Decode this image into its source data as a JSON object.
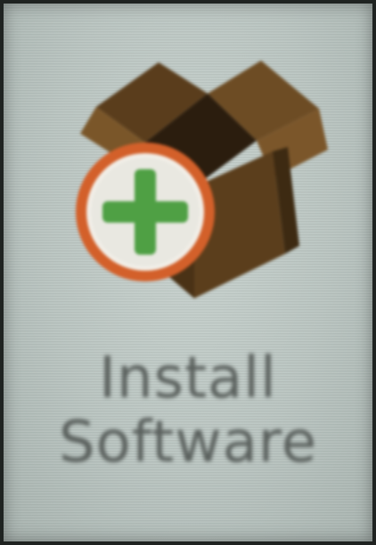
{
  "launcher": {
    "app": {
      "label_line1": "Install",
      "label_line2": "Software",
      "icon": "install-software-box-plus-icon"
    }
  },
  "colors": {
    "screen_background": "#bac5c1",
    "label_text": "#5a605d",
    "box_brown": "#6b4a22",
    "box_dark": "#3a2812",
    "badge_ring": "#d3602a",
    "badge_plus": "#4fa044"
  }
}
